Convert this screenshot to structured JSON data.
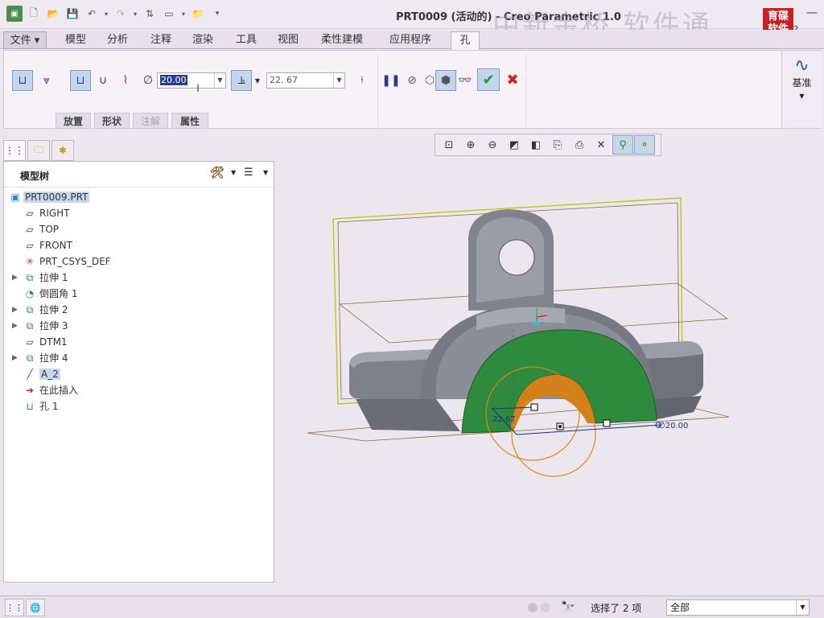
{
  "window": {
    "title": "PRT0009 (活动的) - Creo Parametric 1.0",
    "watermark": "中新金桥  软件通",
    "logo": "育碟软件"
  },
  "tabs": [
    {
      "label": "文件"
    },
    {
      "label": "模型"
    },
    {
      "label": "分析"
    },
    {
      "label": "注释"
    },
    {
      "label": "渲染"
    },
    {
      "label": "工具"
    },
    {
      "label": "视图"
    },
    {
      "label": "柔性建模"
    },
    {
      "label": "应用程序"
    },
    {
      "label": "孔"
    }
  ],
  "ribbon": {
    "diameter_value": "20.00",
    "depth_value": "22. 67",
    "subtabs": [
      "放置",
      "形状",
      "注解",
      "属性"
    ],
    "datum_label": "基准"
  },
  "model_tree": {
    "title": "模型树",
    "items": [
      {
        "label": "PRT0009.PRT",
        "icon": "part-icon"
      },
      {
        "label": "RIGHT",
        "icon": "datum-plane-icon"
      },
      {
        "label": "TOP",
        "icon": "datum-plane-icon"
      },
      {
        "label": "FRONT",
        "icon": "datum-plane-icon"
      },
      {
        "label": "PRT_CSYS_DEF",
        "icon": "csys-icon"
      },
      {
        "label": "拉伸 1",
        "icon": "extrude-icon",
        "expandable": true
      },
      {
        "label": "倒圆角 1",
        "icon": "round-icon"
      },
      {
        "label": "拉伸 2",
        "icon": "extrude-icon",
        "expandable": true
      },
      {
        "label": "拉伸 3",
        "icon": "extrude-icon",
        "expandable": true
      },
      {
        "label": "DTM1",
        "icon": "datum-plane-icon"
      },
      {
        "label": "拉伸 4",
        "icon": "extrude-icon",
        "expandable": true
      },
      {
        "label": "A_2",
        "icon": "axis-icon"
      },
      {
        "label": "在此插入",
        "icon": "insert-arrow-icon"
      },
      {
        "label": "孔 1",
        "icon": "hole-icon"
      }
    ]
  },
  "graphics": {
    "dim_depth": "22.67",
    "dim_diameter": "∅20.00"
  },
  "status": {
    "selection_text": "选择了 2 项",
    "filter_value": "全部"
  },
  "colors": {
    "hole_feature": "#2e8b3e",
    "hole_inner": "#d4801a",
    "part": "#8a8d96",
    "selected_plane": "#b0c400"
  }
}
